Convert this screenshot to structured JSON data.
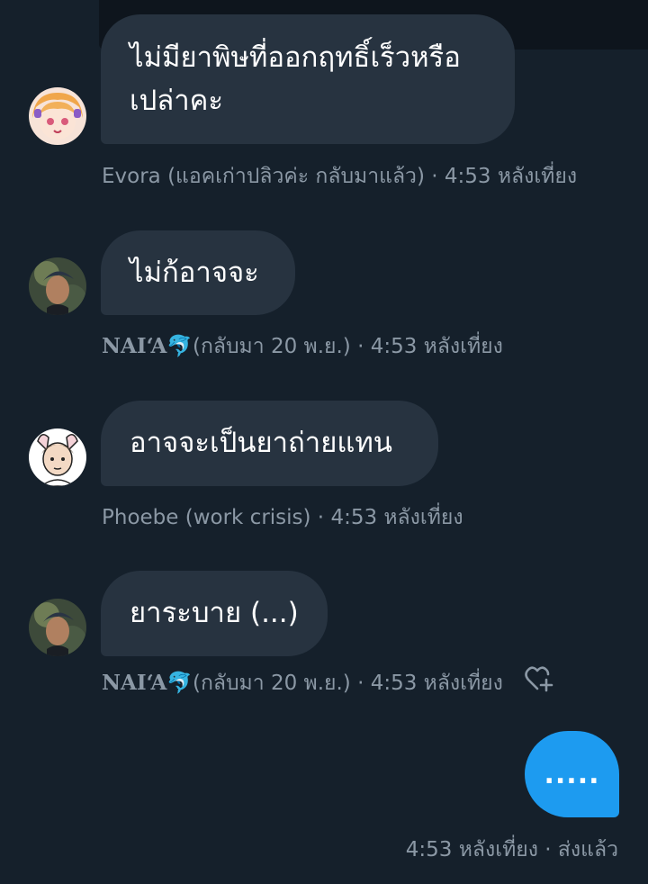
{
  "messages": [
    {
      "text_line1": "ไม่มียาพิษที่ออกฤทธิ์เร็วหรือ",
      "text_line2": "เปล่าคะ",
      "sender": "Evora (แอคเก่าปลิวค่ะ กลับมาแล้ว)",
      "sep": " · ",
      "time": "4:53 หลังเที่ยง"
    },
    {
      "text": "ไม่ก้อาจจะ",
      "sender_styled": "NAI‘A",
      "sender_emoji": "🐬",
      "sender_rest": "(กลับมา 20 พ.ย.)",
      "sep": " · ",
      "time": "4:53 หลังเที่ยง"
    },
    {
      "text": "อาจจะเป็นยาถ่ายแทน",
      "sender": "Phoebe (work crisis)",
      "sep": " · ",
      "time": "4:53 หลังเที่ยง"
    },
    {
      "text": "ยาระบาย (...)",
      "sender_styled": "NAI‘A",
      "sender_emoji": "🐬",
      "sender_rest": "(กลับมา 20 พ.ย.)",
      "sep": " · ",
      "time": "4:53 หลังเที่ยง"
    }
  ],
  "sent_message": {
    "text": ".....",
    "time": "4:53 หลังเที่ยง",
    "sep": " · ",
    "status": "ส่งแล้ว"
  },
  "icons": {
    "reaction": "heart-plus-icon"
  },
  "colors": {
    "background": "#15202b",
    "bubble_received": "#273340",
    "bubble_sent": "#1d9bf0",
    "meta_text": "#8b98a5"
  }
}
